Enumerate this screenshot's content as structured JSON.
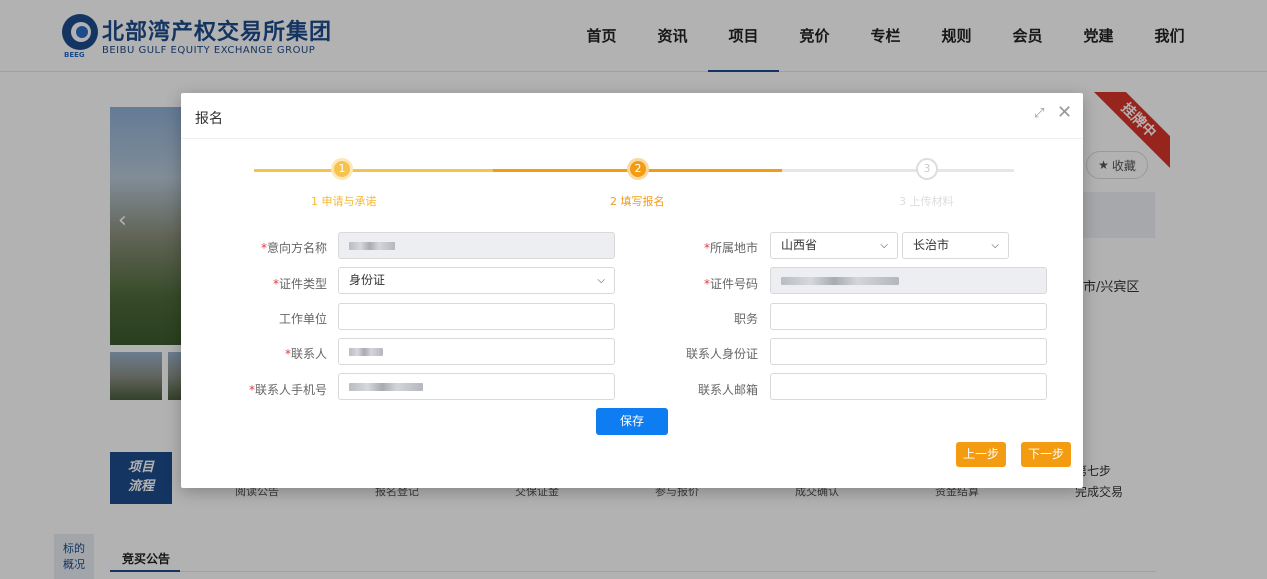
{
  "header": {
    "logo_title": "北部湾产权交易所集团",
    "logo_subtitle": "BEIBU GULF EQUITY EXCHANGE GROUP",
    "logo_tag": "BEEG",
    "nav": [
      "首页",
      "资讯",
      "项目",
      "竞价",
      "专栏",
      "规则",
      "会员",
      "党建",
      "我们"
    ],
    "active_nav": "项目"
  },
  "background": {
    "ribbon": "挂牌中",
    "favorite_label": "收藏",
    "address_fragment": "市/兴宾区",
    "process_label_line1": "项目",
    "process_label_line2": "流程",
    "steps": [
      "阅读公告",
      "报名登记",
      "交保证金",
      "参与报价",
      "成交确认",
      "资金结算"
    ],
    "step7_title": "第七步",
    "step7_label": "完成交易",
    "side_tab_line1": "标的",
    "side_tab_line2": "概况",
    "tab_title": "竞买公告"
  },
  "modal": {
    "title": "报名",
    "steps": [
      {
        "num": "1",
        "label": "1 申请与承诺",
        "state": "done"
      },
      {
        "num": "2",
        "label": "2 填写报名",
        "state": "current"
      },
      {
        "num": "3",
        "label": "3 上传材料",
        "state": "todo"
      }
    ],
    "form": {
      "intent_name_label": "意向方名称",
      "cert_type_label": "证件类型",
      "cert_type_value": "身份证",
      "work_unit_label": "工作单位",
      "contact_label": "联系人",
      "contact_phone_label": "联系人手机号",
      "region_label": "所属地市",
      "province_value": "山西省",
      "city_value": "长治市",
      "cert_no_label": "证件号码",
      "position_label": "职务",
      "contact_id_label": "联系人身份证",
      "contact_email_label": "联系人邮箱"
    },
    "save_label": "保存",
    "prev_label": "上一步",
    "next_label": "下一步"
  },
  "colors": {
    "brand": "#1e4b8c",
    "step_orange": "#f39c12",
    "save_blue": "#0f7df2",
    "required": "#e4393c"
  }
}
